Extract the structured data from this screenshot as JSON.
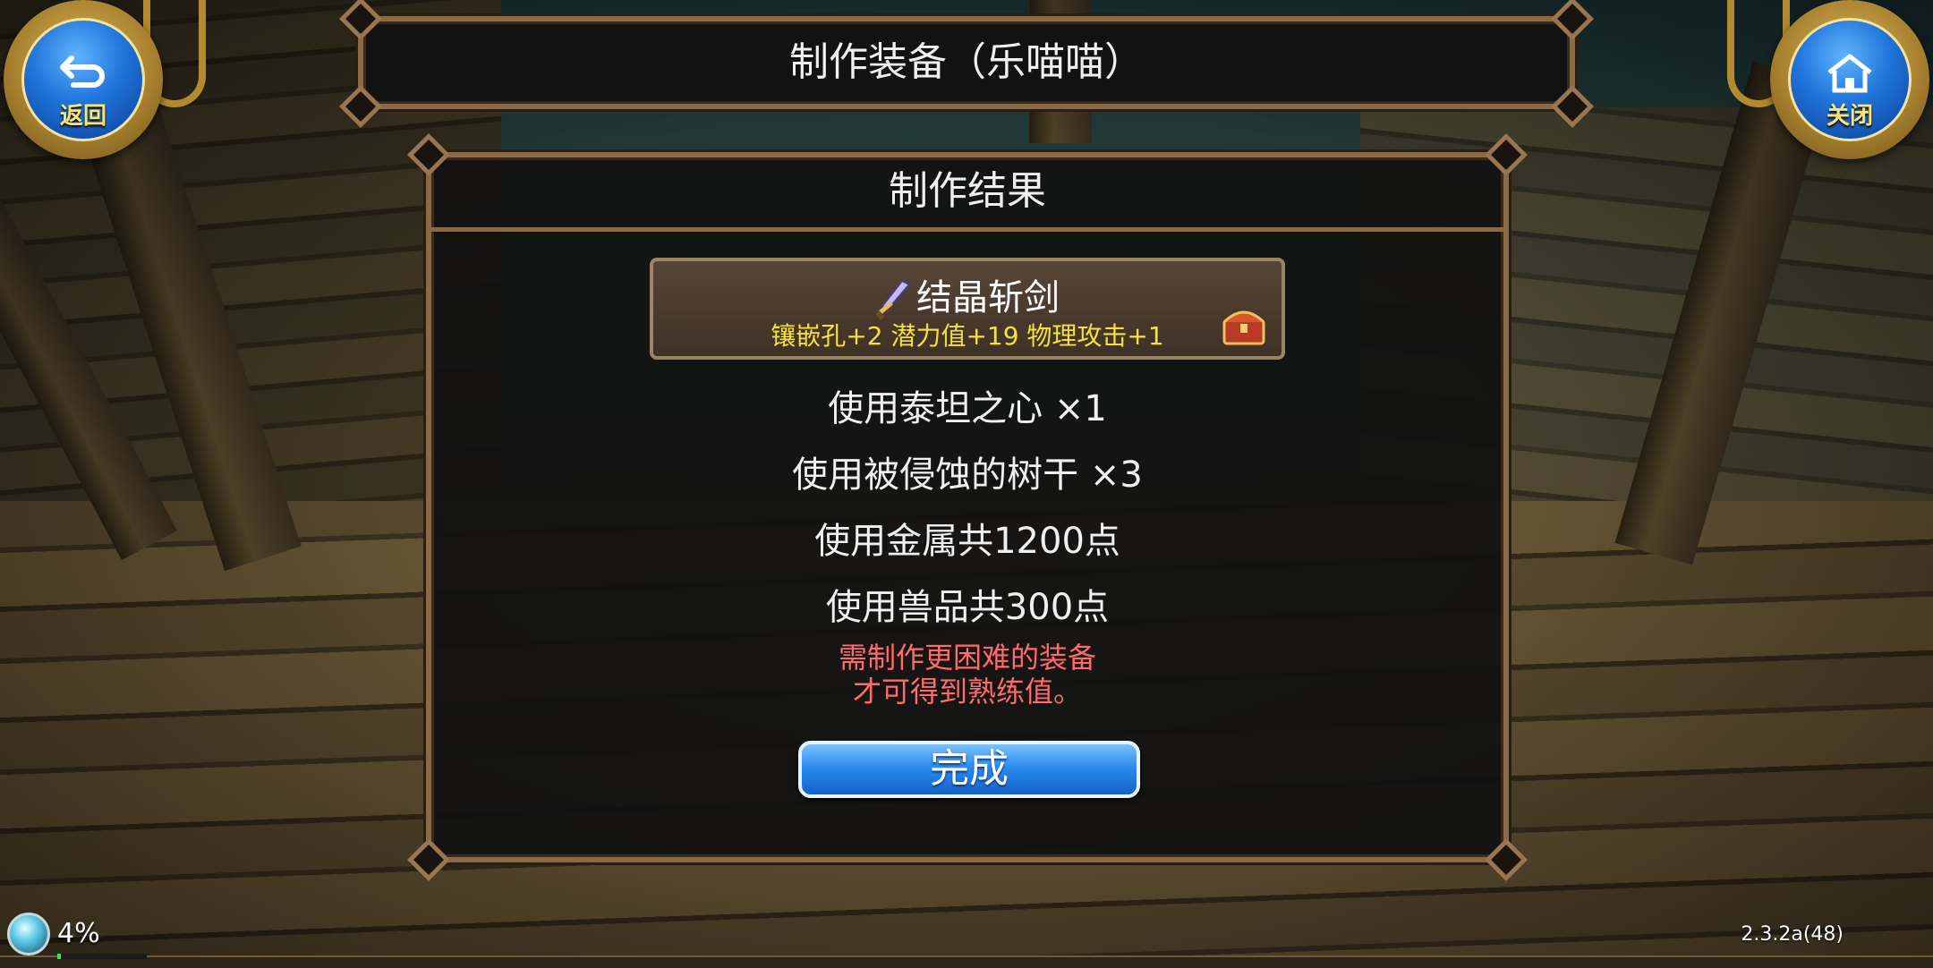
{
  "header": {
    "back_label": "返回",
    "close_label": "关闭",
    "title": "制作装备（乐喵喵）"
  },
  "panel": {
    "title": "制作结果",
    "item": {
      "name": "结晶斩剑",
      "attributes": "镶嵌孔+2 潜力值+19 物理攻击+1",
      "icon": "sword-icon",
      "badge_icon": "treasure-chest-icon"
    },
    "materials": [
      "使用泰坦之心 ×1",
      "使用被侵蚀的树干 ×3",
      "使用金属共1200点",
      "使用兽品共300点"
    ],
    "hint_lines": [
      "需制作更困难的装备",
      "才可得到熟练值。"
    ],
    "done_label": "完成"
  },
  "hud": {
    "percent": "4%",
    "progress": 0.04,
    "version": "2.3.2a(48)"
  },
  "colors": {
    "title_text": "#f0f0f0",
    "attribute_text": "#f2e23a",
    "hint_text": "#ff6a6a",
    "button_blue": "#2b8cf0",
    "frame_brown": "#8a6a46"
  }
}
